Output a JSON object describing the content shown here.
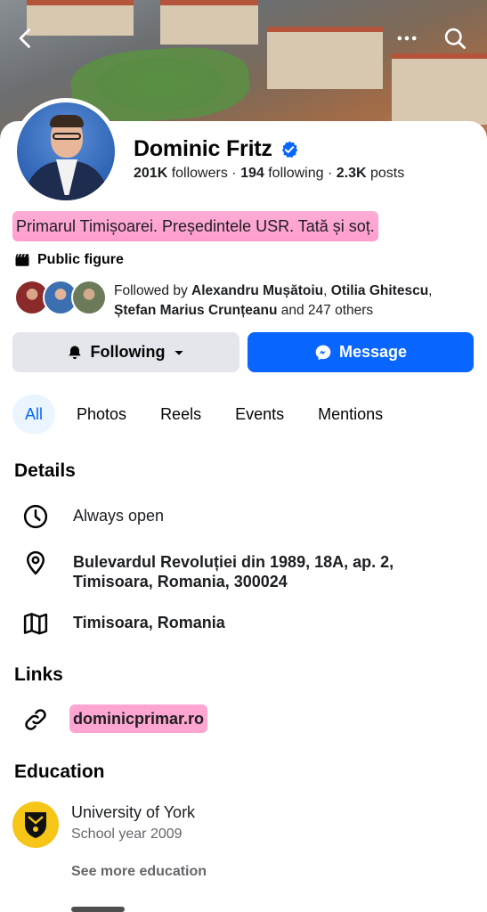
{
  "profile": {
    "name": "Dominic Fritz",
    "followers_count": "201K",
    "followers_label": "followers",
    "following_count": "194",
    "following_label": "following",
    "posts_count": "2.3K",
    "posts_label": "posts",
    "separator": "·",
    "bio": "Primarul Timișoarei. Președintele USR. Tată și soț.",
    "category": "Public figure"
  },
  "followed_by": {
    "prefix": "Followed by ",
    "names_1": "Alexandru Mușătoiu",
    "comma_1": ", ",
    "names_2": "Otilia Ghitescu",
    "comma_2": ", ",
    "names_3": "Ștefan Marius Crunțeanu",
    "suffix": " and 247 others",
    "avatar_colors": [
      "#8b2a2a",
      "#3b6fb0",
      "#6b7b5a"
    ]
  },
  "actions": {
    "following_label": "Following",
    "message_label": "Message"
  },
  "tabs": [
    {
      "label": "All",
      "active": true
    },
    {
      "label": "Photos"
    },
    {
      "label": "Reels"
    },
    {
      "label": "Events"
    },
    {
      "label": "Mentions"
    }
  ],
  "details": {
    "title": "Details",
    "hours": "Always open",
    "address_line1": "Bulevardul Revoluției din 1989, 18A, ap. 2,",
    "address_line2": "Timisoara, Romania, 300024",
    "city": "Timisoara, Romania"
  },
  "links": {
    "title": "Links",
    "website": "dominicprimar.ro"
  },
  "education": {
    "title": "Education",
    "school": "University of York",
    "year": "School year 2009",
    "see_more": "See more education"
  },
  "colors": {
    "accent": "#0866ff",
    "highlight": "#ff69b4",
    "secondary_text": "#65676b",
    "button_gray": "#e4e6eb"
  }
}
